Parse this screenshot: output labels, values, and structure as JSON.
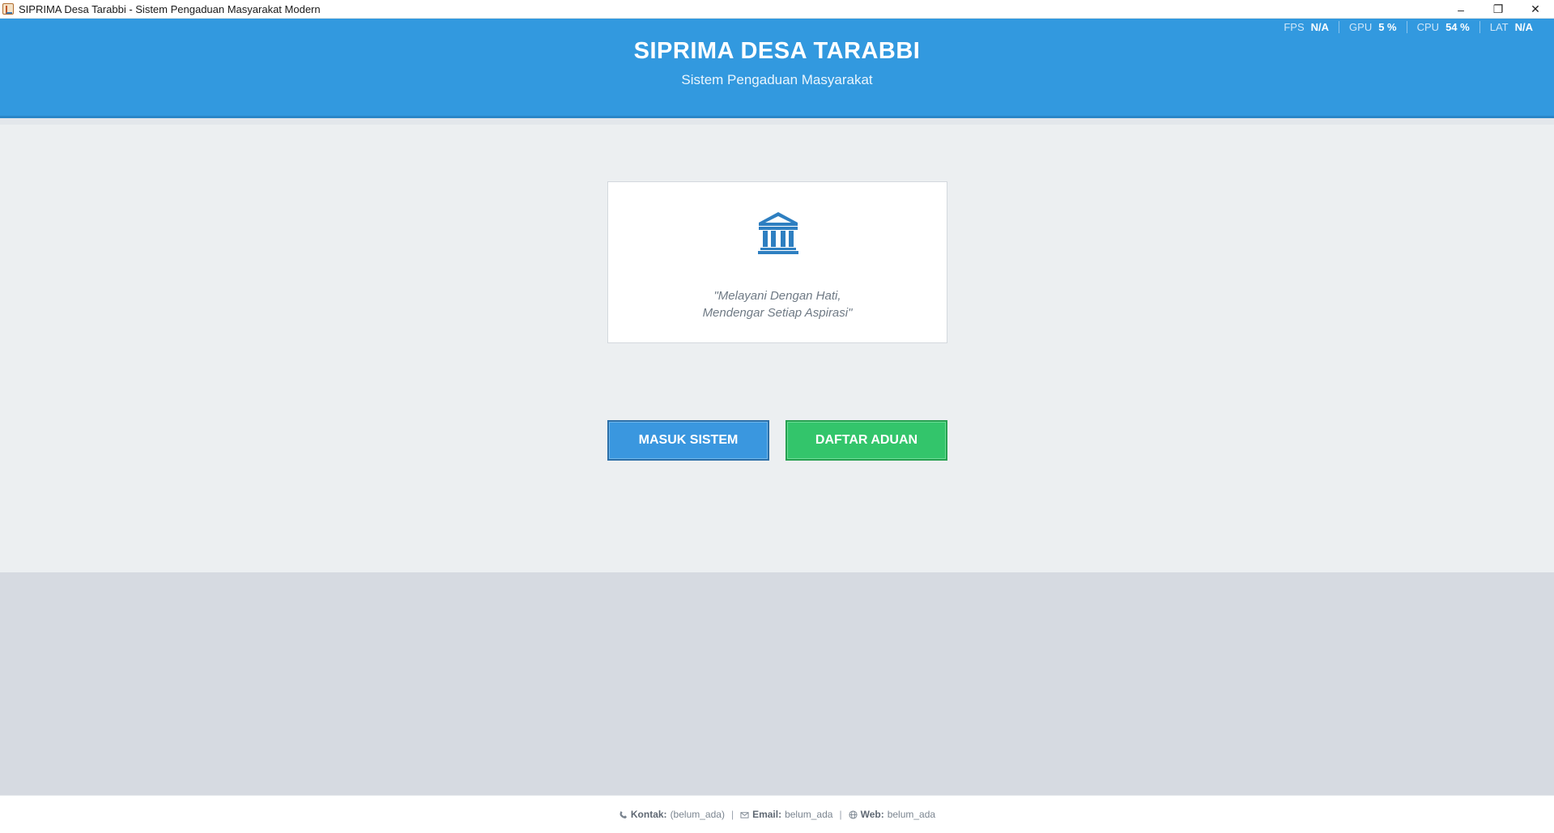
{
  "window": {
    "title": "SIPRIMA Desa Tarabbi - Sistem Pengaduan Masyarakat Modern",
    "controls": {
      "minimize": "–",
      "restore": "❐",
      "close": "✕"
    }
  },
  "stats": [
    {
      "label": "FPS",
      "value": "N/A"
    },
    {
      "label": "GPU",
      "value": "5 %"
    },
    {
      "label": "CPU",
      "value": "54 %"
    },
    {
      "label": "LAT",
      "value": "N/A"
    }
  ],
  "header": {
    "title": "SIPRIMA DESA TARABBI",
    "subtitle": "Sistem Pengaduan Masyarakat"
  },
  "card": {
    "icon": "government-building-icon",
    "quote_line1": "\"Melayani Dengan Hati,",
    "quote_line2": "Mendengar Setiap Aspirasi\""
  },
  "buttons": {
    "login": "MASUK SISTEM",
    "report": "DAFTAR ADUAN"
  },
  "footer": {
    "contact_label": "Kontak:",
    "contact_value": "(belum_ada)",
    "email_label": "Email:",
    "email_value": "belum_ada",
    "web_label": "Web:",
    "web_value": "belum_ada",
    "separator": "|"
  },
  "colors": {
    "header_bg": "#3299df",
    "login_button": "#3a97df",
    "report_button": "#33c56b",
    "icon": "#2e7fc1"
  }
}
